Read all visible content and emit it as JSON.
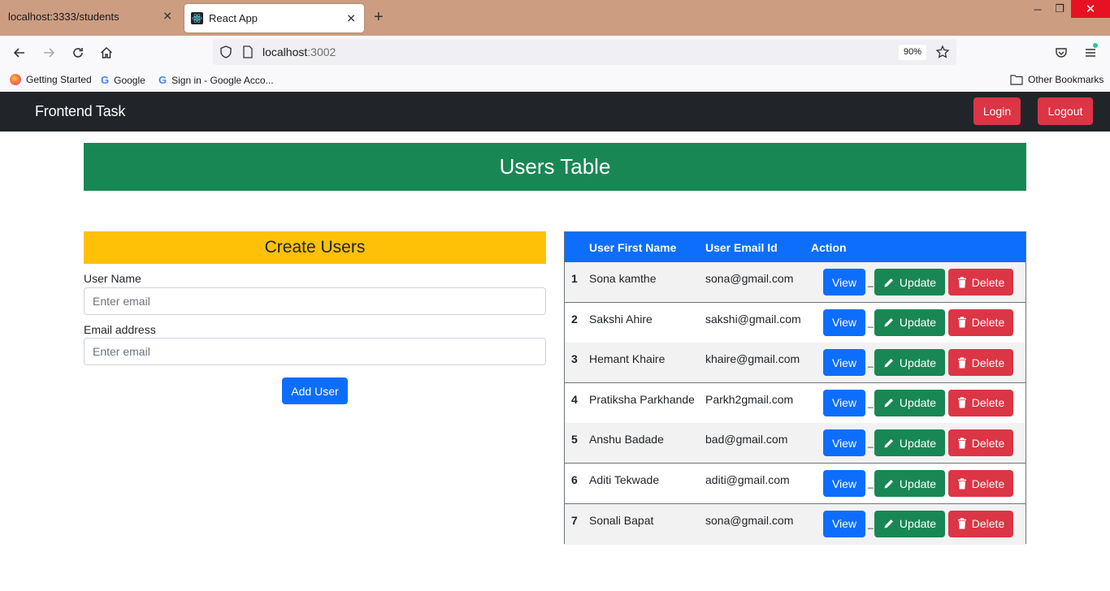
{
  "browser": {
    "tabs": [
      {
        "title": "localhost:3333/students"
      },
      {
        "title": "React App"
      }
    ],
    "url_host": "localhost",
    "url_port": ":3002",
    "zoom": "90%",
    "bookmarks": [
      {
        "label": "Getting Started"
      },
      {
        "label": "Google"
      },
      {
        "label": "Sign in - Google Acco..."
      }
    ],
    "other_bookmarks": "Other Bookmarks"
  },
  "navbar": {
    "brand": "Frontend Task",
    "login_label": "Login",
    "logout_label": "Logout"
  },
  "page": {
    "title": "Users Table"
  },
  "form": {
    "title": "Create Users",
    "username_label": "User Name",
    "username_placeholder": "Enter email",
    "email_label": "Email address",
    "email_placeholder": "Enter email",
    "submit_label": "Add User"
  },
  "table": {
    "headers": {
      "first_name": "User First Name",
      "email": "User Email Id",
      "action": "Action"
    },
    "view_label": "View",
    "update_label": "Update",
    "delete_label": "Delete",
    "separator": "_",
    "rows": [
      {
        "num": "1",
        "first_name": "Sona kamthe",
        "email": "sona@gmail.com"
      },
      {
        "num": "2",
        "first_name": "Sakshi Ahire",
        "email": "sakshi@gmail.com"
      },
      {
        "num": "3",
        "first_name": "Hemant Khaire",
        "email": "khaire@gmail.com"
      },
      {
        "num": "4",
        "first_name": "Pratiksha Parkhande",
        "email": "Parkh2gmail.com"
      },
      {
        "num": "5",
        "first_name": "Anshu Badade",
        "email": "bad@gmail.com"
      },
      {
        "num": "6",
        "first_name": "Aditi Tekwade",
        "email": "aditi@gmail.com"
      },
      {
        "num": "7",
        "first_name": "Sonali Bapat",
        "email": "sona@gmail.com"
      }
    ]
  },
  "colors": {
    "navbar": "#212529",
    "success": "#198754",
    "warning": "#ffc107",
    "primary": "#0d6efd",
    "danger": "#dc3545"
  }
}
